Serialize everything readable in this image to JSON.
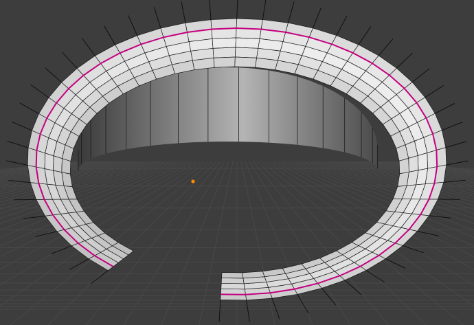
{
  "viewport": {
    "background_color": "#3d3d3d",
    "grid_color": "#484848",
    "mesh": {
      "face_light_color": "#f0f0f0",
      "face_dark_color": "#8a8a8a",
      "inner_wall_dark_color": "#3a3a3a",
      "inner_wall_light_color": "#b4b4b4",
      "wire_color": "#1a1a1a",
      "seam_color": "#c4007f",
      "normal_line_color": "#111111"
    },
    "origin_point": {
      "color": "#ff8a00",
      "icon": "origin-dot-icon"
    }
  }
}
